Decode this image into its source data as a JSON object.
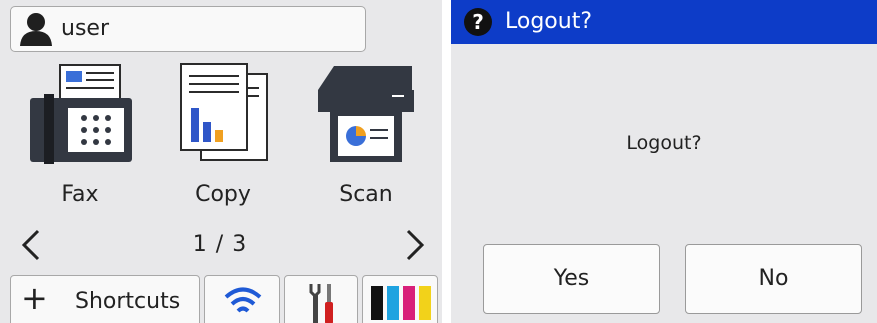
{
  "home": {
    "user": {
      "name": "user",
      "icon": "user-icon"
    },
    "apps": [
      {
        "label": "Fax",
        "icon": "fax-icon"
      },
      {
        "label": "Copy",
        "icon": "copy-icon"
      },
      {
        "label": "Scan",
        "icon": "scan-icon"
      }
    ],
    "page_indicator": "1 / 3",
    "prev_icon": "chevron-left-icon",
    "next_icon": "chevron-right-icon",
    "bottom_bar": {
      "shortcuts_label": "Shortcuts",
      "shortcuts_icon": "plus-icon",
      "wifi_icon": "wifi-icon",
      "settings_icon": "tools-icon",
      "ink_icon": "ink-cartridges-icon"
    }
  },
  "dialog": {
    "title": "Logout?",
    "title_icon": "question-icon",
    "message": "Logout?",
    "yes_label": "Yes",
    "no_label": "No",
    "title_bar_color": "#0d3cc8"
  }
}
